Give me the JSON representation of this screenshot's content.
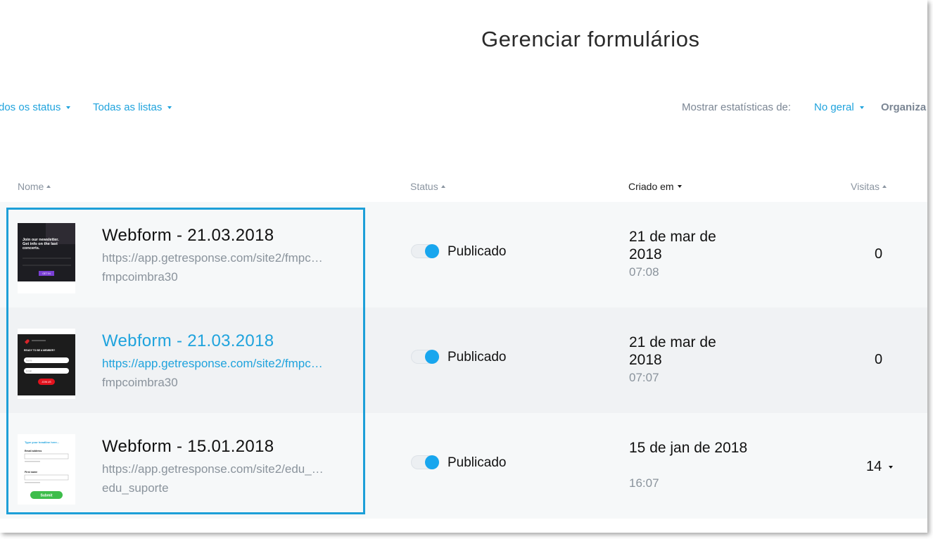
{
  "header": {
    "title": "Gerenciar formulários"
  },
  "filters": {
    "status_label": "dos os status",
    "lists_label": "Todas as listas",
    "stats_label": "Mostrar estatísticas de:",
    "stats_value": "No geral",
    "organize_label": "Organiza"
  },
  "columns": {
    "name": "Nome",
    "status": "Status",
    "created": "Criado em",
    "visits": "Visitas"
  },
  "colors": {
    "accent": "#1fa3dd",
    "toggle_on": "#18a6ee",
    "selection_border": "#1d9fd8"
  },
  "rows": [
    {
      "name": "Webform - 21.03.2018",
      "url": "https://app.getresponse.com/site2/fmpc…",
      "owner": "fmpcoimbra30",
      "status": "Publicado",
      "date": "21 de mar de 2018",
      "time": "07:08",
      "visits": "0",
      "thumbnail": {
        "line1": "Join our newsletter.",
        "line2": "Get info on the last",
        "line3": "concerts.",
        "button": "GET IN"
      }
    },
    {
      "name": "Webform - 21.03.2018",
      "url": "https://app.getresponse.com/site2/fmpc…",
      "owner": "fmpcoimbra30",
      "status": "Publicado",
      "date": "21 de mar de 2018",
      "time": "07:07",
      "visits": "0",
      "thumbnail": {
        "heading": "READY TO BE A MEMBER?",
        "field1": "Name",
        "field2": "Email",
        "button": "JOIN US"
      }
    },
    {
      "name": "Webform - 15.01.2018",
      "url": "https://app.getresponse.com/site2/edu_…",
      "owner": "edu_suporte",
      "status": "Publicado",
      "date": "15 de jan de 2018",
      "time": "16:07",
      "visits": "14",
      "thumbnail": {
        "headline": "Type your headline here...",
        "label1": "Email address",
        "label2": "First name",
        "button": "Submit"
      }
    }
  ]
}
